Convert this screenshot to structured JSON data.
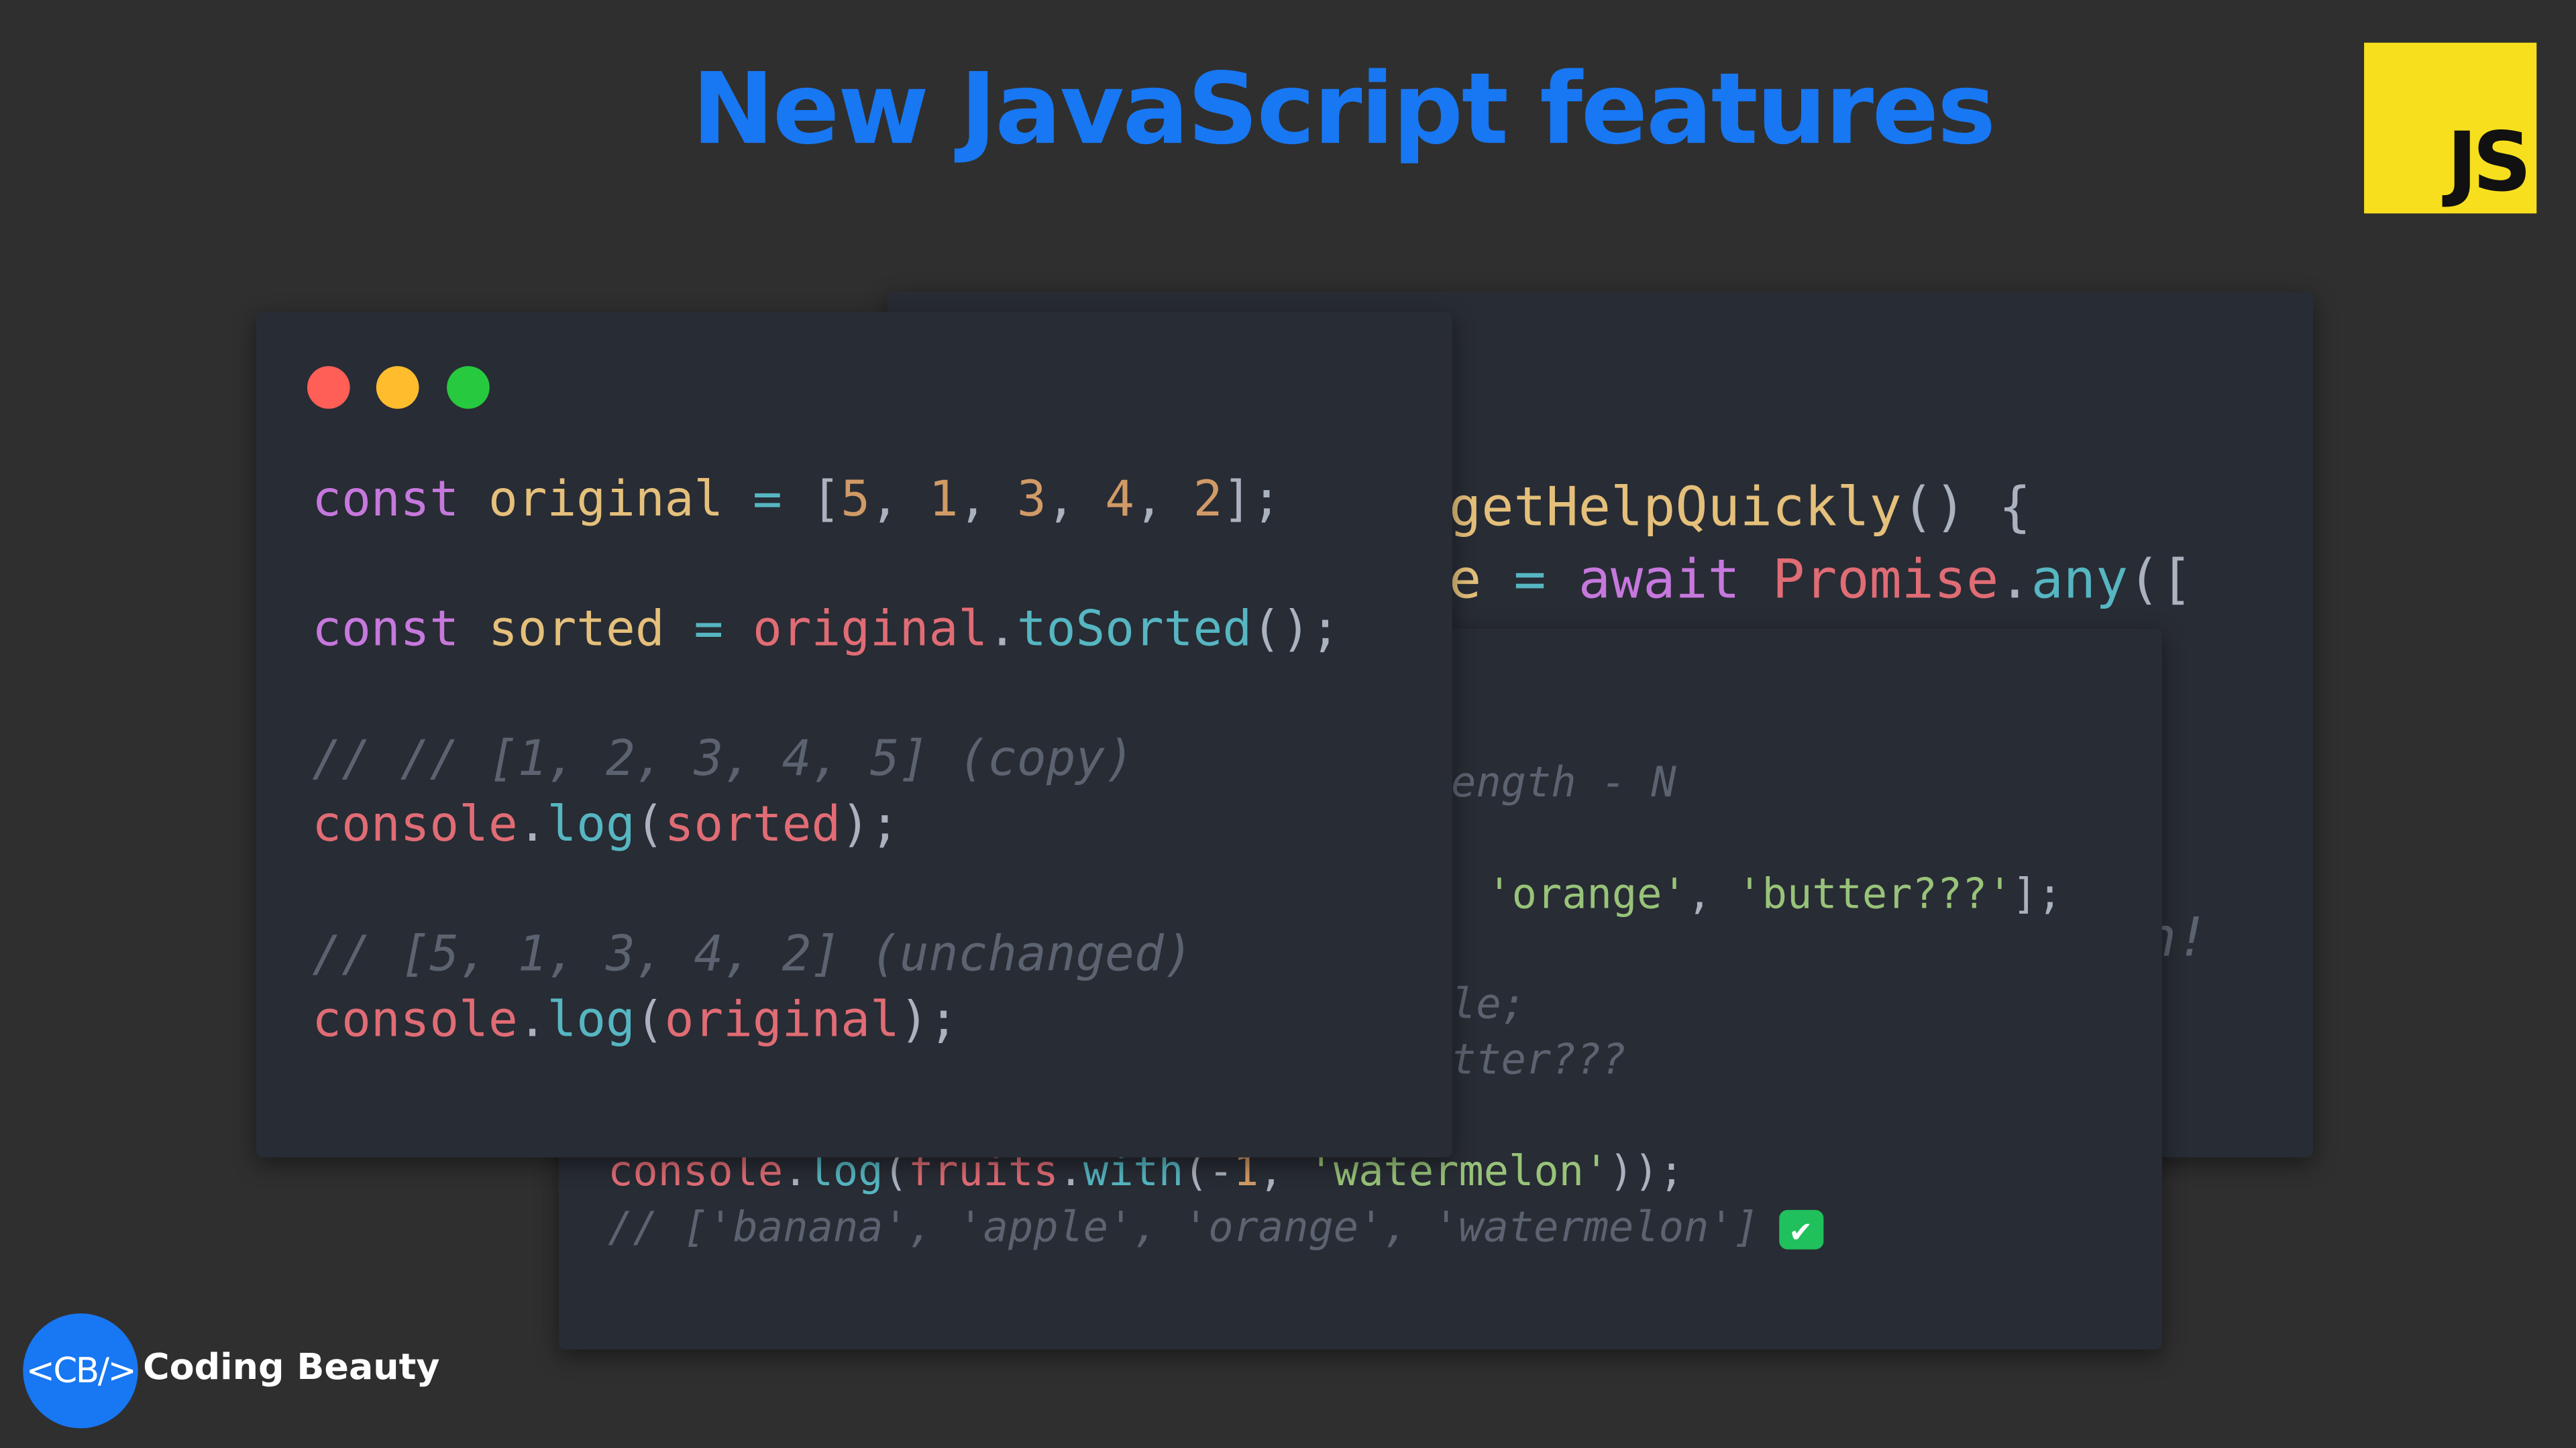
{
  "title": "New JavaScript features",
  "js_logo": "JS",
  "brand": {
    "logo": "<CB/>",
    "name": "Coding Beauty"
  },
  "colors": {
    "accent": "#1877f2",
    "js_yellow": "#f7df1e",
    "window_bg": "#282c34",
    "dot_red": "#ff5f56",
    "dot_yellow": "#ffbd2e",
    "dot_green": "#27c93f"
  },
  "back_window": {
    "lines": [
      [
        {
          "t": "getHelpQuickly",
          "c": "var"
        },
        {
          "t": "() {",
          "c": "pun"
        }
      ],
      [
        {
          "t": "e ",
          "c": "var"
        },
        {
          "t": "= ",
          "c": "op"
        },
        {
          "t": "await ",
          "c": "kw"
        },
        {
          "t": "Promise",
          "c": "obj"
        },
        {
          "t": ".",
          "c": "pun"
        },
        {
          "t": "any",
          "c": "fn"
        },
        {
          "t": "([",
          "c": "pun"
        }
      ],
      [
        {
          "t": "n!",
          "c": "cm"
        }
      ]
    ]
  },
  "middle_window": {
    "lines": [
      [
        {
          "t": "length - N",
          "c": "cm"
        }
      ],
      [
        {
          "t": "'orange'",
          "c": "str"
        },
        {
          "t": ", ",
          "c": "pun"
        },
        {
          "t": "'butter???'",
          "c": "str"
        },
        {
          "t": "];",
          "c": "pun"
        }
      ],
      [
        {
          "t": "ple;",
          "c": "cm"
        }
      ],
      [
        {
          "t": "utter???",
          "c": "cm"
        }
      ],
      [
        {
          "t": "console",
          "c": "obj"
        },
        {
          "t": ".",
          "c": "pun"
        },
        {
          "t": "log",
          "c": "fn"
        },
        {
          "t": "(",
          "c": "pun"
        },
        {
          "t": "fruits",
          "c": "obj"
        },
        {
          "t": ".",
          "c": "pun"
        },
        {
          "t": "with",
          "c": "fn"
        },
        {
          "t": "(-",
          "c": "pun"
        },
        {
          "t": "1",
          "c": "num"
        },
        {
          "t": ", ",
          "c": "pun"
        },
        {
          "t": "'watermelon'",
          "c": "str"
        },
        {
          "t": "));",
          "c": "pun"
        }
      ],
      [
        {
          "t": "// ['banana', 'apple', 'orange', 'watermelon']",
          "c": "cm"
        },
        {
          "t": "✔",
          "c": "check"
        }
      ]
    ]
  },
  "front_window": {
    "lines": [
      [
        {
          "t": "const ",
          "c": "kw"
        },
        {
          "t": "original ",
          "c": "var"
        },
        {
          "t": "= ",
          "c": "op"
        },
        {
          "t": "[",
          "c": "pun"
        },
        {
          "t": "5",
          "c": "num"
        },
        {
          "t": ", ",
          "c": "pun"
        },
        {
          "t": "1",
          "c": "num"
        },
        {
          "t": ", ",
          "c": "pun"
        },
        {
          "t": "3",
          "c": "num"
        },
        {
          "t": ", ",
          "c": "pun"
        },
        {
          "t": "4",
          "c": "num"
        },
        {
          "t": ", ",
          "c": "pun"
        },
        {
          "t": "2",
          "c": "num"
        },
        {
          "t": "];",
          "c": "pun"
        }
      ],
      [
        {
          "t": "const ",
          "c": "kw"
        },
        {
          "t": "sorted ",
          "c": "var"
        },
        {
          "t": "= ",
          "c": "op"
        },
        {
          "t": "original",
          "c": "obj"
        },
        {
          "t": ".",
          "c": "pun"
        },
        {
          "t": "toSorted",
          "c": "fn"
        },
        {
          "t": "();",
          "c": "pun"
        }
      ],
      [
        {
          "t": "// // [1, 2, 3, 4, 5] (copy)",
          "c": "cm"
        }
      ],
      [
        {
          "t": "console",
          "c": "obj"
        },
        {
          "t": ".",
          "c": "pun"
        },
        {
          "t": "log",
          "c": "fn"
        },
        {
          "t": "(",
          "c": "pun"
        },
        {
          "t": "sorted",
          "c": "obj"
        },
        {
          "t": ");",
          "c": "pun"
        }
      ],
      [
        {
          "t": "// [5, 1, 3, 4, 2] (unchanged)",
          "c": "cm"
        }
      ],
      [
        {
          "t": "console",
          "c": "obj"
        },
        {
          "t": ".",
          "c": "pun"
        },
        {
          "t": "log",
          "c": "fn"
        },
        {
          "t": "(",
          "c": "pun"
        },
        {
          "t": "original",
          "c": "obj"
        },
        {
          "t": ");",
          "c": "pun"
        }
      ]
    ]
  }
}
